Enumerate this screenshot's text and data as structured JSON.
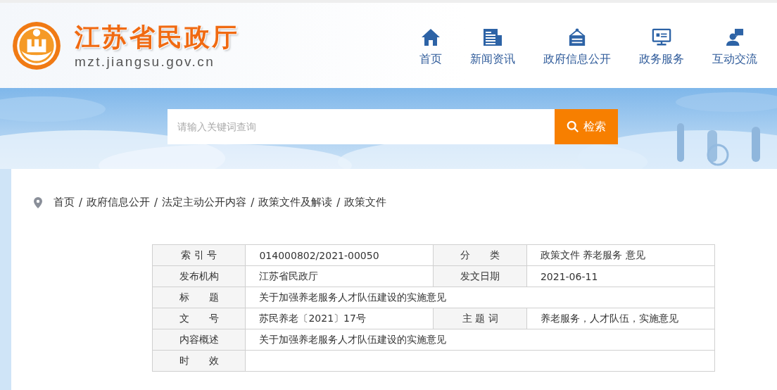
{
  "site": {
    "title": "江苏省民政厅",
    "domain": "mzt.jiangsu.gov.cn"
  },
  "nav": [
    {
      "label": "首页"
    },
    {
      "label": "新闻资讯"
    },
    {
      "label": "政府信息公开"
    },
    {
      "label": "政务服务"
    },
    {
      "label": "互动交流"
    }
  ],
  "search": {
    "placeholder": "请输入关键词查询",
    "button": "检索"
  },
  "hero": {
    "kind": "picture"
  },
  "breadcrumb": [
    {
      "label": "首页"
    },
    {
      "separator": "/",
      "label": "政府信息公开"
    },
    {
      "separator": "/",
      "label": "法定主动公开内容"
    },
    {
      "separator": "/",
      "label": "政策文件及解读"
    },
    {
      "separator": "/",
      "label": "政策文件"
    }
  ],
  "info_rows": [
    [
      {
        "label": "索 引 号",
        "value": "014000802/2021-00050"
      },
      {
        "label": "分　　类",
        "value": "政策文件 养老服务 意见"
      }
    ],
    [
      {
        "label": "发布机构",
        "value": "江苏省民政厅"
      },
      {
        "label": "发文日期",
        "value": "2021-06-11"
      }
    ],
    [
      {
        "label": "标　　题",
        "value": "关于加强养老服务人才队伍建设的实施意见"
      }
    ],
    [
      {
        "label": "文　　号",
        "value": "苏民养老〔2021〕17号"
      },
      {
        "label": "主 题 词",
        "value": "养老服务，人才队伍，实施意见"
      }
    ],
    [
      {
        "label": "内容概述",
        "value": "关于加强养老服务人才队伍建设的实施意见"
      }
    ],
    [
      {
        "label": "时　　效"
      }
    ]
  ]
}
